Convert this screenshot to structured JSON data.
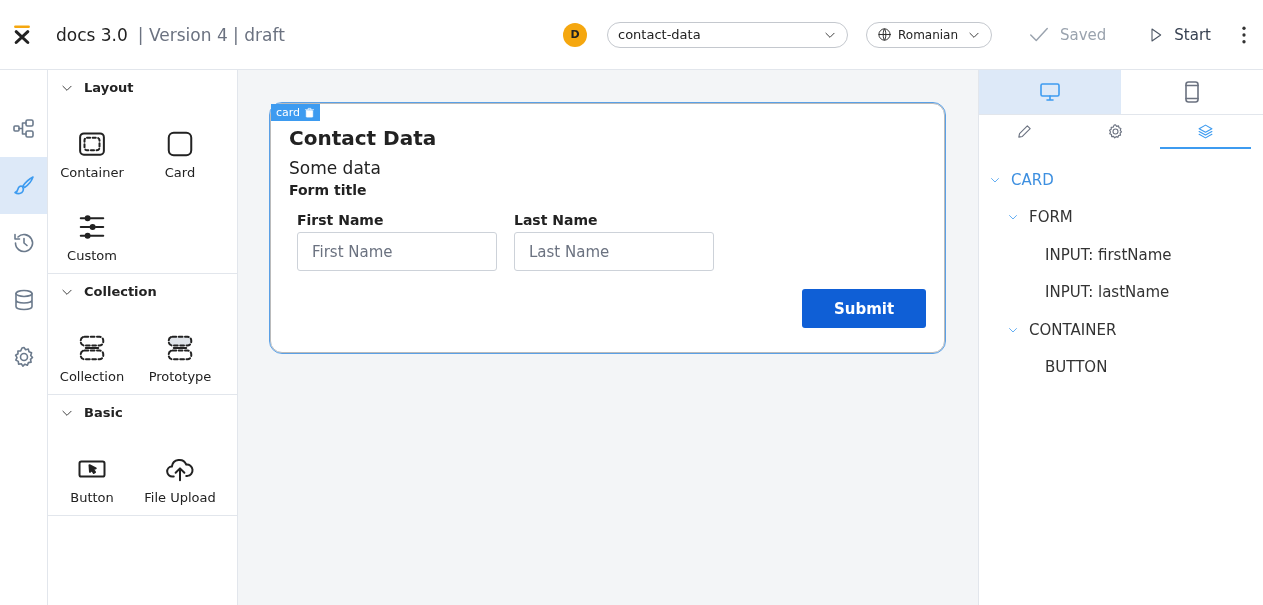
{
  "header": {
    "app_name": "docs 3.0",
    "version": "| Version 4 | draft",
    "avatar": "D",
    "page_select": {
      "value": "contact-data"
    },
    "language_select": {
      "value": "Romanian"
    },
    "saved": {
      "label": "Saved",
      "disabled": true
    },
    "start": {
      "label": "Start"
    }
  },
  "nav_rail": [
    {
      "kind": "structure",
      "selected": false
    },
    {
      "kind": "brush",
      "selected": true
    },
    {
      "kind": "history",
      "selected": false
    },
    {
      "kind": "database",
      "selected": false
    },
    {
      "kind": "settings",
      "selected": false
    }
  ],
  "palette": [
    {
      "title": "Layout",
      "expanded": true,
      "items": [
        {
          "label": "Container",
          "kind": "container"
        },
        {
          "label": "Card",
          "kind": "card"
        },
        {
          "label": "Custom",
          "kind": "custom"
        }
      ]
    },
    {
      "title": "Collection",
      "expanded": true,
      "items": [
        {
          "label": "Collection",
          "kind": "collection"
        },
        {
          "label": "Prototype",
          "kind": "prototype"
        }
      ]
    },
    {
      "title": "Basic",
      "expanded": true,
      "items": [
        {
          "label": "Button",
          "kind": "button"
        },
        {
          "label": "File Upload",
          "kind": "upload"
        }
      ]
    }
  ],
  "canvas": {
    "card": {
      "tag": "card",
      "selected": true,
      "title": "Contact Data",
      "subtitle": "Some data",
      "form_title": "Form title",
      "fields": [
        {
          "label": "First Name",
          "placeholder": "First Name"
        },
        {
          "label": "Last Name",
          "placeholder": "Last Name"
        }
      ],
      "button": "Submit"
    }
  },
  "right_panel": {
    "device_tabs": [
      {
        "kind": "desktop",
        "selected": true
      },
      {
        "kind": "mobile",
        "selected": false
      }
    ],
    "panel_tabs": [
      {
        "kind": "edit",
        "selected": false
      },
      {
        "kind": "settings",
        "selected": false
      },
      {
        "kind": "layers",
        "selected": true
      }
    ],
    "tree": [
      {
        "label": "CARD",
        "expanded": true,
        "selected": true,
        "children": [
          {
            "label": "FORM",
            "expanded": true,
            "selected": false,
            "children": [
              {
                "label": "INPUT: firstName",
                "selected": false
              },
              {
                "label": "INPUT: lastName",
                "selected": false
              }
            ]
          },
          {
            "label": "CONTAINER",
            "expanded": true,
            "selected": false,
            "children": [
              {
                "label": "BUTTON",
                "selected": false
              }
            ]
          }
        ]
      }
    ]
  }
}
